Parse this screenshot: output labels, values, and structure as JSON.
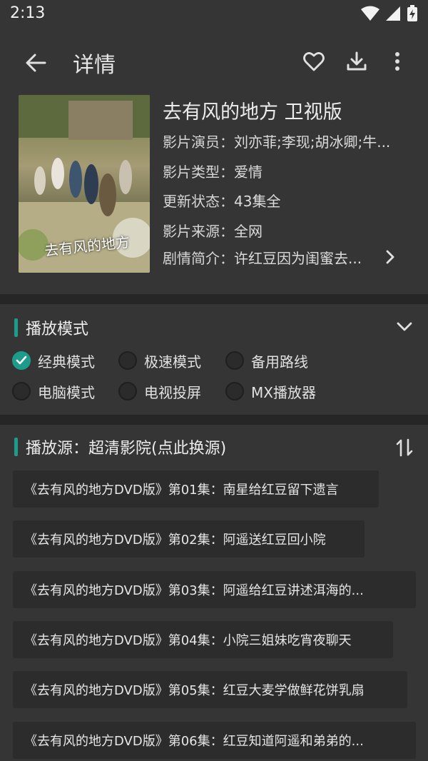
{
  "status": {
    "time": "2:13"
  },
  "app_bar": {
    "title": "详情"
  },
  "movie": {
    "title": "去有风的地方 卫视版",
    "poster_caption": "去有风的地方",
    "rows": [
      {
        "key": "影片演员：",
        "value": "刘亦菲;李现;胡冰卿;牛..."
      },
      {
        "key": "影片类型：",
        "value": "爱情"
      },
      {
        "key": "更新状态：",
        "value": "43集全"
      },
      {
        "key": "影片来源：",
        "value": "全网"
      },
      {
        "key": "剧情简介：",
        "value": "许红豆因为闺蜜去..."
      }
    ]
  },
  "play_mode": {
    "title": "播放模式",
    "options": [
      {
        "label": "经典模式",
        "checked": true
      },
      {
        "label": "极速模式",
        "checked": false
      },
      {
        "label": "备用路线",
        "checked": false
      },
      {
        "label": "电脑模式",
        "checked": false
      },
      {
        "label": "电视投屏",
        "checked": false
      },
      {
        "label": "MX播放器",
        "checked": false
      }
    ]
  },
  "source": {
    "title": "播放源：超清影院(点此换源)",
    "episodes": [
      "《去有风的地方DVD版》第01集：南星给红豆留下遗言",
      "《去有风的地方DVD版》第02集：阿遥送红豆回小院",
      "《去有风的地方DVD版》第03集：阿遥给红豆讲述洱海的...",
      "《去有风的地方DVD版》第04集：小院三姐妹吃宵夜聊天",
      "《去有风的地方DVD版》第05集：红豆大麦学做鲜花饼乳扇",
      "《去有风的地方DVD版》第06集：红豆知道阿遥和弟弟的..."
    ]
  },
  "colors": {
    "accent": "#1e9c8b",
    "background": "#353535",
    "divider": "#262626"
  }
}
